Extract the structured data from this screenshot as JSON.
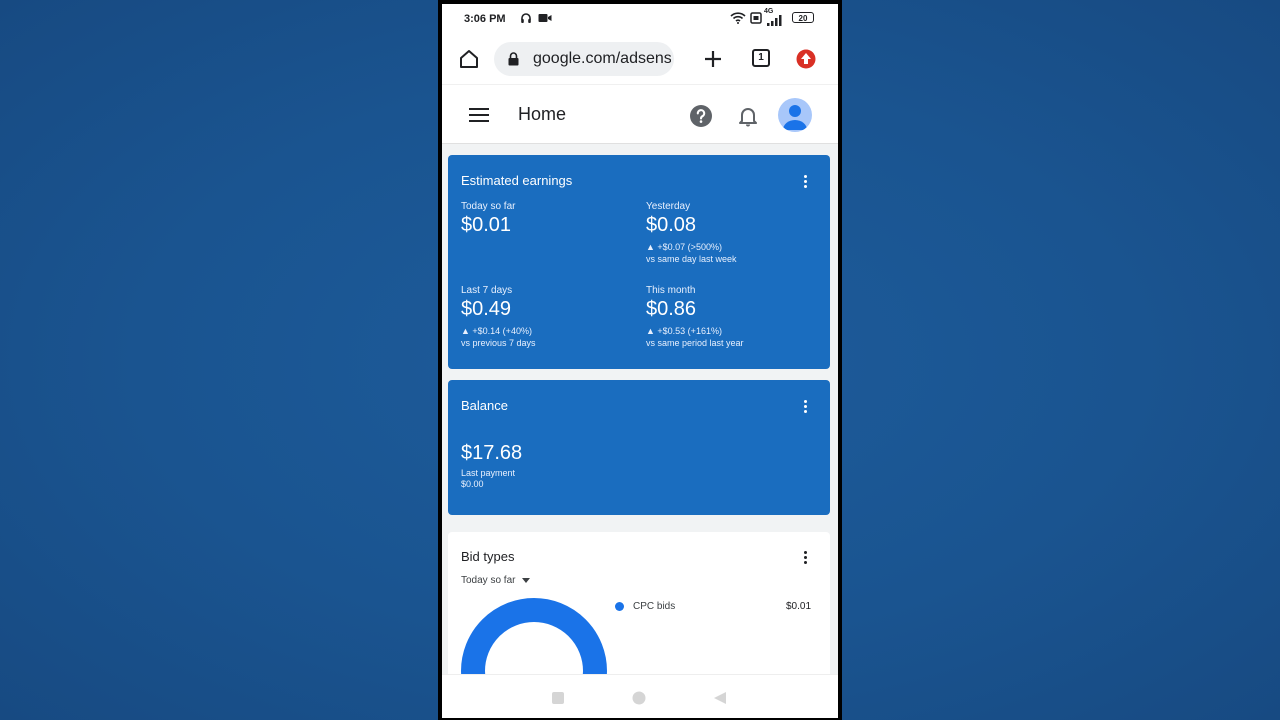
{
  "statusbar": {
    "time": "3:06 PM",
    "battery": "20",
    "network": "4G"
  },
  "browser": {
    "url": "google.com/adsense",
    "tab_count": "1"
  },
  "appbar": {
    "title": "Home"
  },
  "estimated_earnings": {
    "title": "Estimated earnings",
    "metrics": [
      {
        "label": "Today so far",
        "value": "$0.01",
        "delta": "",
        "compare": ""
      },
      {
        "label": "Yesterday",
        "value": "$0.08",
        "delta": "▲ +$0.07 (>500%)",
        "compare": "vs same day last week"
      },
      {
        "label": "Last 7 days",
        "value": "$0.49",
        "delta": "▲ +$0.14 (+40%)",
        "compare": "vs previous 7 days"
      },
      {
        "label": "This month",
        "value": "$0.86",
        "delta": "▲ +$0.53 (+161%)",
        "compare": "vs same period last year"
      }
    ]
  },
  "balance": {
    "title": "Balance",
    "value": "$17.68",
    "last_payment_label": "Last payment",
    "last_payment_value": "$0.00"
  },
  "bid_types": {
    "title": "Bid types",
    "period": "Today so far",
    "legend": [
      {
        "name": "CPC bids",
        "value": "$0.01",
        "color": "#1a73e8"
      }
    ]
  },
  "colors": {
    "card_blue": "#1a6dbf",
    "accent": "#1a73e8",
    "chrome_red": "#d93025"
  }
}
